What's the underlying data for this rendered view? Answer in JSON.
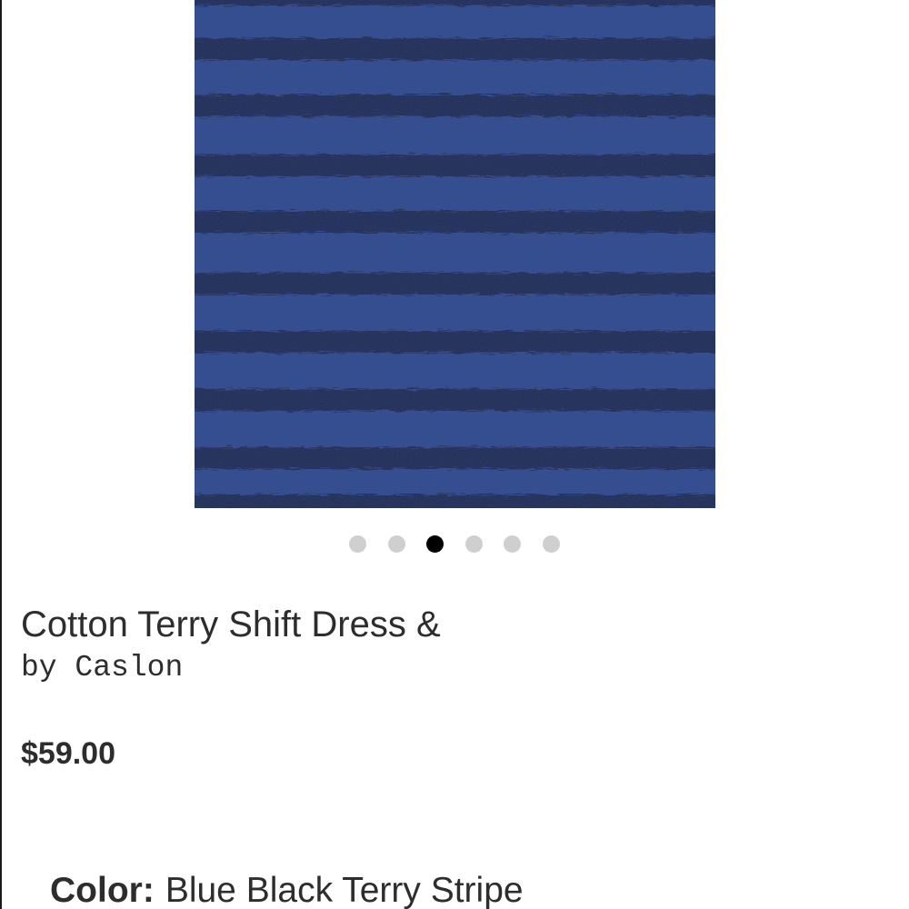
{
  "product": {
    "image_alt": "Cotton Terry Shift Dress & by Caslon, Blue Black Terry Stripe",
    "title": "Cotton Terry Shift Dress &",
    "by_prefix": "by",
    "brand": "Caslon",
    "price": "$59.00",
    "color_label": "Color:",
    "color_value": "Blue  Black Terry Stripe"
  },
  "carousel": {
    "total_slides": 6,
    "active_slide": 3
  },
  "colors": {
    "fabric_blue": "#2f4a8f",
    "stripe_dark": "#1c2748",
    "dot_active": "#000000",
    "dot_inactive": "#cfcfcf",
    "text": "#2d2d2d"
  }
}
